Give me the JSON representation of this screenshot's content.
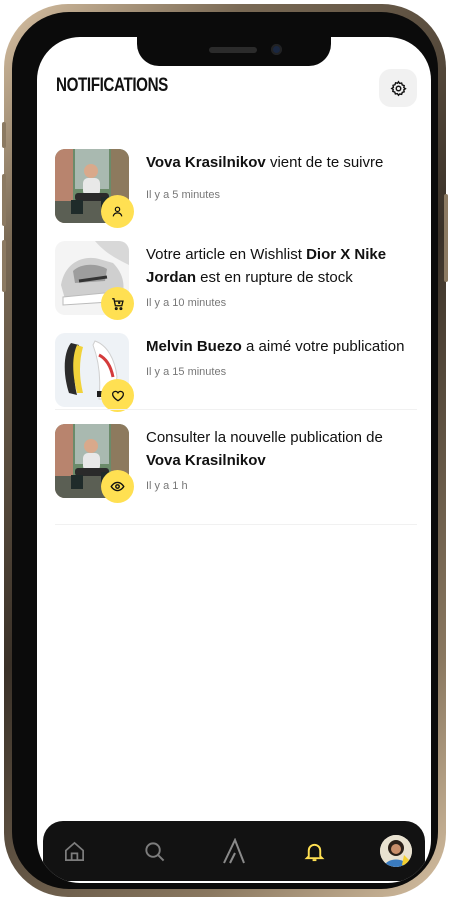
{
  "header": {
    "title": "NOTIFICATIONS",
    "settings_icon": "gear-icon"
  },
  "notifications": [
    {
      "bold_start": "Vova Krasilnikov",
      "text": " vient de te suivre",
      "time": "Il y a 5 minutes",
      "badge_icon": "user-icon",
      "thumb": "person-photo"
    },
    {
      "text_start": "Votre article en Wishlist ",
      "bold": "Dior X Nike Jordan",
      "text_end": " est en rupture de stock",
      "time": "Il y a 10 minutes",
      "badge_icon": "cart-icon",
      "thumb": "sneaker-photo"
    },
    {
      "bold_start": "Melvin Buezo",
      "text": " a aimé votre publication",
      "time": "Il y a 15 minutes",
      "badge_icon": "heart-icon",
      "thumb": "sneaker-photo-2"
    },
    {
      "text_start": "Consulter la nouvelle publication de ",
      "bold": "Vova Krasilnikov",
      "time": "Il y a 1 h",
      "badge_icon": "eye-icon",
      "thumb": "person-photo"
    }
  ],
  "tabbar": {
    "items": [
      "home-icon",
      "search-icon",
      "brand-logo-icon",
      "bell-icon",
      "profile-avatar"
    ],
    "active": "bell-icon",
    "active_color": "#ffe052"
  },
  "colors": {
    "accent": "#ffe052",
    "tabbar_bg": "#121212"
  }
}
